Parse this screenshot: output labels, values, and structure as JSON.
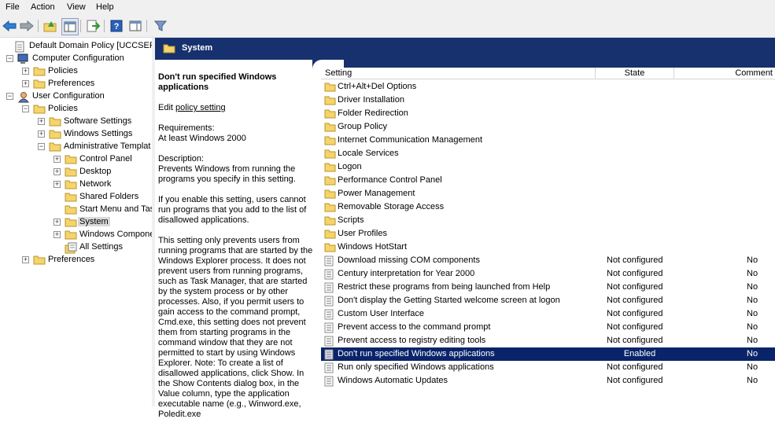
{
  "menu": [
    "File",
    "Action",
    "View",
    "Help"
  ],
  "toolbar": {
    "icons": [
      "back-icon",
      "forward-icon",
      "up-folder-icon",
      "show-hide-tree-icon",
      "export-list-icon",
      "help-icon",
      "properties-pane-icon",
      "filter-icon"
    ]
  },
  "tree": {
    "items": [
      {
        "label": "Default Domain Policy [UCCSERVER",
        "icon": "policy-icon",
        "expander": ""
      },
      {
        "label": "Computer Configuration",
        "icon": "computer-icon",
        "expander": "−"
      },
      {
        "label": "Policies",
        "icon": "folder-icon",
        "expander": "+"
      },
      {
        "label": "Preferences",
        "icon": "folder-icon",
        "expander": "+"
      },
      {
        "label": "User Configuration",
        "icon": "user-icon",
        "expander": "−"
      },
      {
        "label": "Policies",
        "icon": "folder-icon",
        "expander": "−"
      },
      {
        "label": "Software Settings",
        "icon": "folder-icon",
        "expander": "+"
      },
      {
        "label": "Windows Settings",
        "icon": "folder-icon",
        "expander": "+"
      },
      {
        "label": "Administrative Templat",
        "icon": "folder-icon",
        "expander": "−"
      },
      {
        "label": "Control Panel",
        "icon": "folder-icon",
        "expander": "+"
      },
      {
        "label": "Desktop",
        "icon": "folder-icon",
        "expander": "+"
      },
      {
        "label": "Network",
        "icon": "folder-icon",
        "expander": "+"
      },
      {
        "label": "Shared Folders",
        "icon": "folder-icon",
        "expander": ""
      },
      {
        "label": "Start Menu and Tas",
        "icon": "folder-icon",
        "expander": ""
      },
      {
        "label": "System",
        "icon": "folder-icon",
        "expander": "+",
        "selected": true
      },
      {
        "label": "Windows Compone",
        "icon": "folder-icon",
        "expander": "+"
      },
      {
        "label": "All Settings",
        "icon": "settings-icon",
        "expander": ""
      },
      {
        "label": "Preferences",
        "icon": "folder-icon",
        "expander": "+"
      }
    ]
  },
  "header": {
    "title": "System"
  },
  "description": {
    "title": "Don't run specified Windows applications",
    "edit_prefix": "Edit ",
    "edit_link": "policy setting ",
    "requirements_label": "Requirements:",
    "requirements_value": "At least Windows 2000",
    "description_label": "Description:",
    "para1": "Prevents Windows from running the programs you specify in this setting.",
    "para2": "If you enable this setting, users cannot run programs that you add to the list of disallowed applications.",
    "para3": "This setting only prevents users from running programs that are started by the Windows Explorer process. It does not prevent users from running programs, such as Task Manager, that are started by the system process or by other processes. Also, if you permit users to gain access to the command prompt, Cmd.exe, this setting does not prevent them from starting programs in the command window that they are not permitted to start by using Windows Explorer. Note: To create a list of disallowed applications, click Show. In the Show Contents dialog box, in the Value column, type the application executable name (e.g., Winword.exe, Poledit.exe"
  },
  "list": {
    "columns": [
      "Setting",
      "State",
      "Comment"
    ],
    "rows": [
      {
        "name": "Ctrl+Alt+Del Options",
        "type": "folder",
        "state": "",
        "comment": ""
      },
      {
        "name": "Driver Installation",
        "type": "folder",
        "state": "",
        "comment": ""
      },
      {
        "name": "Folder Redirection",
        "type": "folder",
        "state": "",
        "comment": ""
      },
      {
        "name": "Group Policy",
        "type": "folder",
        "state": "",
        "comment": ""
      },
      {
        "name": "Internet Communication Management",
        "type": "folder",
        "state": "",
        "comment": ""
      },
      {
        "name": "Locale Services",
        "type": "folder",
        "state": "",
        "comment": ""
      },
      {
        "name": "Logon",
        "type": "folder",
        "state": "",
        "comment": ""
      },
      {
        "name": "Performance Control Panel",
        "type": "folder",
        "state": "",
        "comment": ""
      },
      {
        "name": "Power Management",
        "type": "folder",
        "state": "",
        "comment": ""
      },
      {
        "name": "Removable Storage Access",
        "type": "folder",
        "state": "",
        "comment": ""
      },
      {
        "name": "Scripts",
        "type": "folder",
        "state": "",
        "comment": ""
      },
      {
        "name": "User Profiles",
        "type": "folder",
        "state": "",
        "comment": ""
      },
      {
        "name": "Windows HotStart",
        "type": "folder",
        "state": "",
        "comment": ""
      },
      {
        "name": "Download missing COM components",
        "type": "setting",
        "state": "Not configured",
        "comment": "No"
      },
      {
        "name": "Century interpretation for Year 2000",
        "type": "setting",
        "state": "Not configured",
        "comment": "No"
      },
      {
        "name": "Restrict these programs from being launched from Help",
        "type": "setting",
        "state": "Not configured",
        "comment": "No"
      },
      {
        "name": "Don't display the Getting Started welcome screen at logon",
        "type": "setting",
        "state": "Not configured",
        "comment": "No"
      },
      {
        "name": "Custom User Interface",
        "type": "setting",
        "state": "Not configured",
        "comment": "No"
      },
      {
        "name": "Prevent access to the command prompt",
        "type": "setting",
        "state": "Not configured",
        "comment": "No"
      },
      {
        "name": "Prevent access to registry editing tools",
        "type": "setting",
        "state": "Not configured",
        "comment": "No"
      },
      {
        "name": "Don't run specified Windows applications",
        "type": "setting",
        "state": "Enabled",
        "comment": "No",
        "selected": true
      },
      {
        "name": "Run only specified Windows applications",
        "type": "setting",
        "state": "Not configured",
        "comment": "No"
      },
      {
        "name": "Windows Automatic Updates",
        "type": "setting",
        "state": "Not configured",
        "comment": "No"
      }
    ]
  },
  "colors": {
    "header_bg": "#17306e",
    "selection_bg": "#0a246a",
    "folder": "#f5d46b"
  }
}
